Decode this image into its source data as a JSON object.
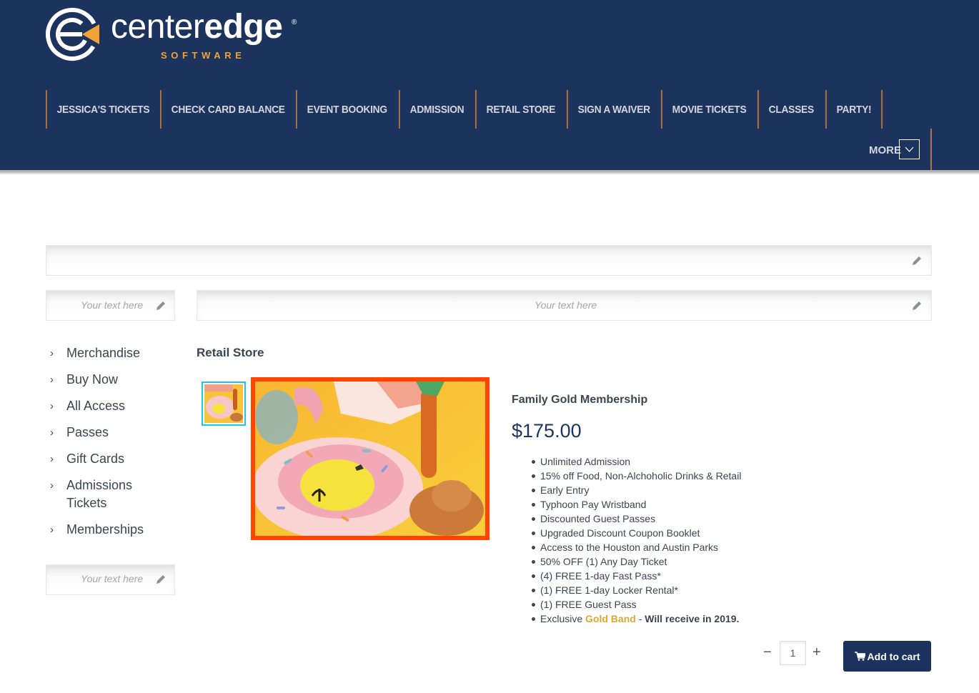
{
  "brand": {
    "name_light": "center",
    "name_bold": "edge",
    "registered": "®",
    "tagline": "SOFTWARE",
    "colors": {
      "navy": "#1b335d",
      "orange": "#f1a33a",
      "nav_divider": "#b8733a",
      "image_border": "#ff4500",
      "thumb_border": "#1ec5f2",
      "gold": "#e2a532"
    }
  },
  "nav": {
    "items": [
      {
        "label": "JESSICA'S TICKETS"
      },
      {
        "label": "CHECK CARD BALANCE"
      },
      {
        "label": "EVENT BOOKING"
      },
      {
        "label": "ADMISSION"
      },
      {
        "label": "RETAIL STORE"
      },
      {
        "label": "SIGN A WAIVER"
      },
      {
        "label": "MOVIE TICKETS"
      },
      {
        "label": "CLASSES"
      },
      {
        "label": "PARTY!"
      }
    ],
    "more_label": "MORE"
  },
  "editable": {
    "top_banner_text": "",
    "left_top_text": "Your text here",
    "center_text": "Your text here",
    "left_bottom_text": "Your text here"
  },
  "sidebar": {
    "items": [
      {
        "label": "Merchandise"
      },
      {
        "label": "Buy Now"
      },
      {
        "label": "All Access"
      },
      {
        "label": "Passes"
      },
      {
        "label": "Gift Cards"
      },
      {
        "label": "Admissions Tickets"
      },
      {
        "label": "Memberships"
      }
    ]
  },
  "main": {
    "section_title": "Retail Store",
    "product": {
      "name": "Family Gold Membership",
      "price": "$175.00",
      "image_alt": "Inflatable donut pool float, palm tree and straw hat on yellow background",
      "features": [
        "Unlimited Admission",
        "15% off Food, Non-Alchoholic Drinks & Retail",
        "Early Entry",
        "Typhoon Pay Wristband",
        "Discounted Guest Passes",
        "Upgraded Discount Coupon Booklet",
        "Access to the Houston and Austin Parks",
        "50% OFF (1) Any Day Ticket",
        "(4) FREE 1-day Fast Pass*",
        "(1) FREE 1-day Locker Rental*",
        "(1) FREE Guest Pass"
      ],
      "last_feature": {
        "prefix": "Exclusive ",
        "highlight": "Gold Band",
        "separator": " - ",
        "bold_suffix": "Will receive in 2019."
      }
    },
    "cart": {
      "minus": "−",
      "quantity": "1",
      "plus": "+",
      "add_label": "Add to cart"
    }
  }
}
